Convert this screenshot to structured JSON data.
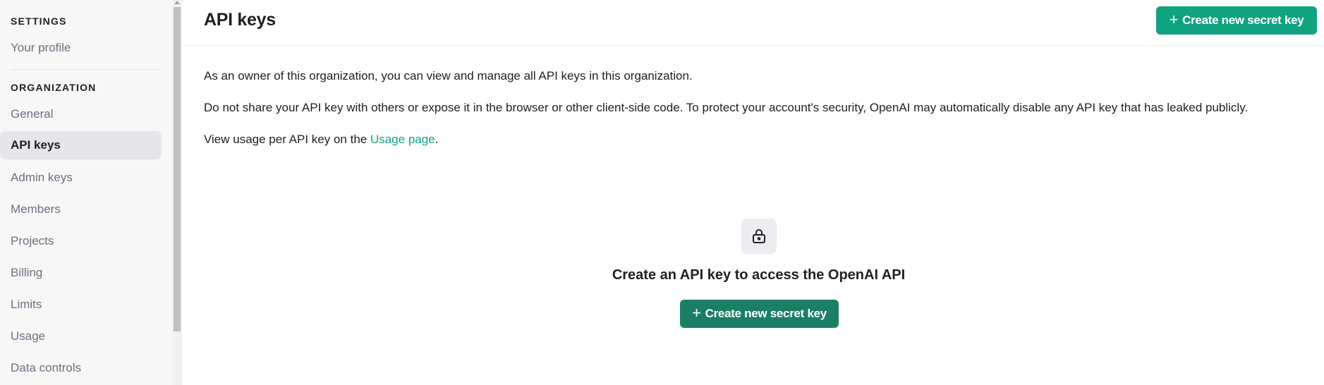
{
  "sidebar": {
    "settings_title": "SETTINGS",
    "your_profile": "Your profile",
    "organization_title": "ORGANIZATION",
    "items": [
      {
        "label": "General"
      },
      {
        "label": "API keys"
      },
      {
        "label": "Admin keys"
      },
      {
        "label": "Members"
      },
      {
        "label": "Projects"
      },
      {
        "label": "Billing"
      },
      {
        "label": "Limits"
      },
      {
        "label": "Usage"
      },
      {
        "label": "Data controls"
      }
    ],
    "active_item": "API keys"
  },
  "header": {
    "title": "API keys",
    "create_button_label": "Create new secret key"
  },
  "main": {
    "paragraph_1": "As an owner of this organization, you can view and manage all API keys in this organization.",
    "paragraph_2": "Do not share your API key with others or expose it in the browser or other client-side code. To protect your account's security, OpenAI may automatically disable any API key that has leaked publicly.",
    "paragraph_3_prefix": "View usage per API key on the ",
    "paragraph_3_link": "Usage page",
    "paragraph_3_suffix": "."
  },
  "empty_state": {
    "icon": "lock-icon",
    "title": "Create an API key to access the OpenAI API",
    "button_label": "Create new secret key"
  },
  "colors": {
    "accent": "#10a37f",
    "accent_dark": "#1a7f64",
    "sidebar_bg": "#f7f7f8",
    "active_item_bg": "#e5e5ea"
  }
}
